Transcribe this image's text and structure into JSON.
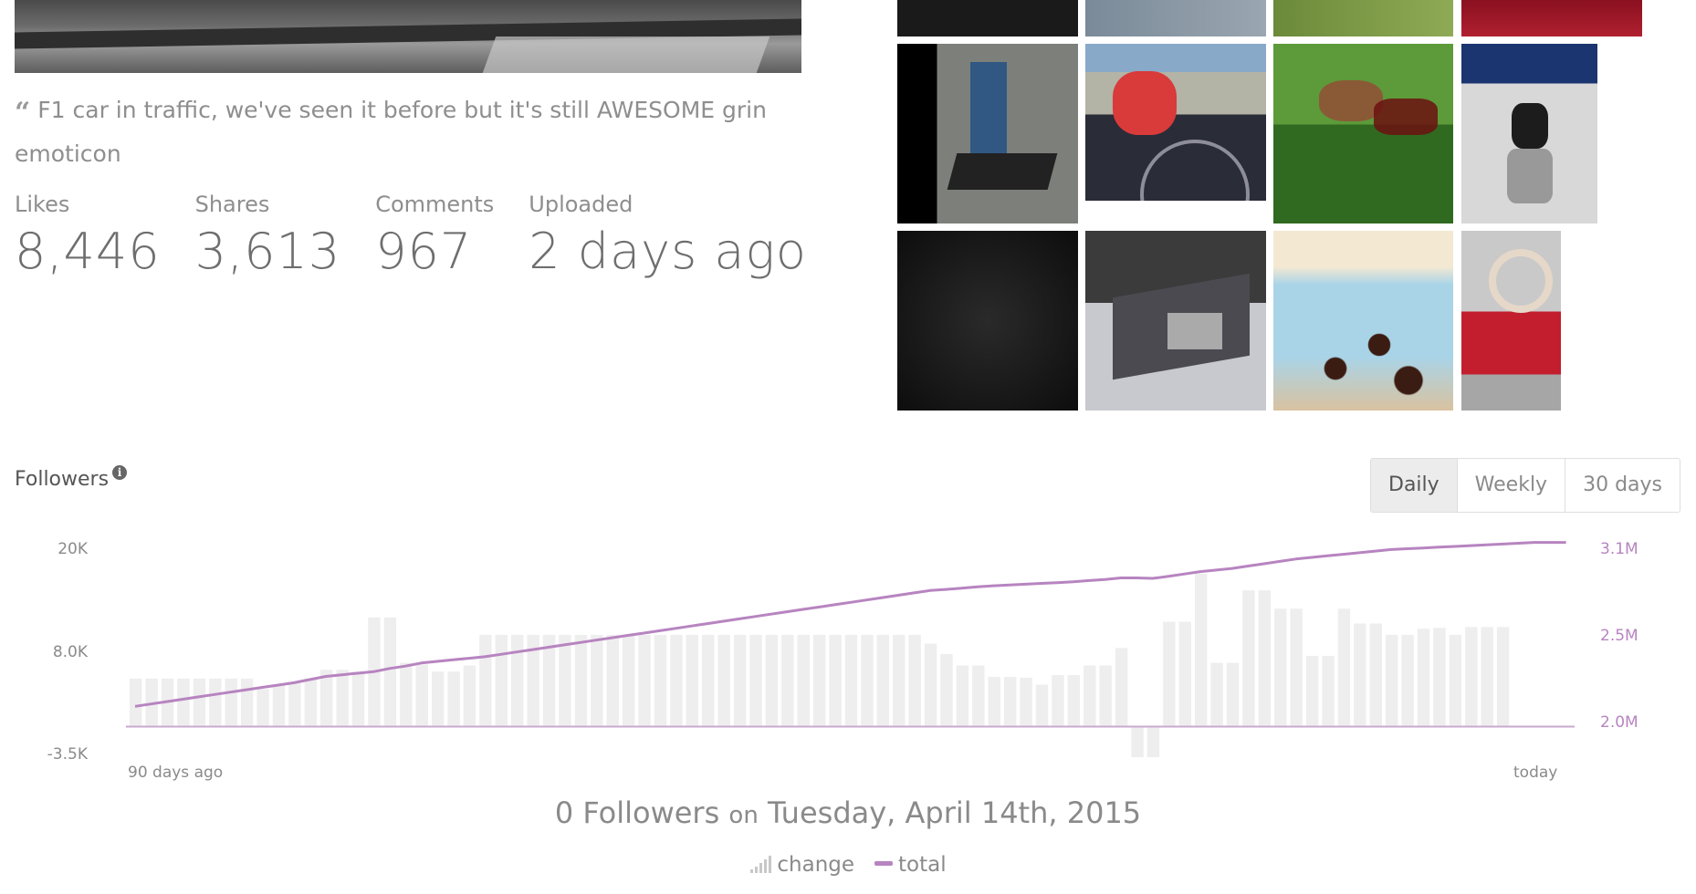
{
  "post": {
    "caption": "F1 car in traffic, we've seen it before but it's still AWESOME grin emoticon",
    "stats": [
      {
        "label": "Likes",
        "value": "8,446"
      },
      {
        "label": "Shares",
        "value": "3,613"
      },
      {
        "label": "Comments",
        "value": "967"
      },
      {
        "label": "Uploaded",
        "value": "2 days ago"
      }
    ]
  },
  "followers": {
    "title": "Followers",
    "periods": [
      "Daily",
      "Weekly",
      "30 days"
    ],
    "active_period": "Daily",
    "y_left_ticks": [
      "20K",
      "8.0K",
      "-3.5K"
    ],
    "y_right_ticks": [
      "3.1M",
      "2.5M",
      "2.0M"
    ],
    "x_start_label": "90 days ago",
    "x_end_label": "today",
    "summary": {
      "value": "0 Followers",
      "on": "on",
      "date": "Tuesday, April 14th, 2015"
    },
    "legend": {
      "change": "change",
      "total": "total"
    },
    "colors": {
      "bars": "#eeeeee",
      "line": "#b784c0",
      "baseline": "#c9a9cf"
    }
  },
  "chart_data": {
    "type": "bar",
    "x_range": [
      "90 days ago",
      "today"
    ],
    "ylim_left": [
      -3500,
      20000
    ],
    "ylim_right": [
      2000000,
      3100000
    ],
    "series": [
      {
        "name": "change",
        "type": "bar",
        "values": [
          5500,
          5500,
          5500,
          5500,
          5500,
          5500,
          5500,
          5500,
          4300,
          4700,
          5100,
          5500,
          6500,
          6500,
          6300,
          12500,
          12500,
          7300,
          7100,
          6300,
          6300,
          7000,
          10500,
          10500,
          10500,
          10500,
          10500,
          10500,
          10500,
          10500,
          10500,
          10500,
          10500,
          10500,
          10500,
          10500,
          10500,
          10500,
          10500,
          10500,
          10500,
          10500,
          10500,
          10500,
          10500,
          10500,
          10500,
          10500,
          10500,
          10500,
          9500,
          8300,
          7000,
          7000,
          5700,
          5700,
          5600,
          4800,
          5900,
          5900,
          7000,
          7000,
          9000,
          -3500,
          -3500,
          12000,
          12000,
          17500,
          7300,
          7300,
          15600,
          15600,
          13500,
          13500,
          8100,
          8100,
          13500,
          11800,
          11800,
          10500,
          10500,
          11200,
          11300,
          10500,
          11400,
          11400,
          11400,
          0,
          0,
          0,
          0
        ],
        "note_zero": ""
      },
      {
        "name": "total",
        "type": "line",
        "values": [
          2120000,
          2135000,
          2150000,
          2165000,
          2180000,
          2195000,
          2210000,
          2225000,
          2240000,
          2255000,
          2270000,
          2290000,
          2310000,
          2320000,
          2330000,
          2340000,
          2360000,
          2375000,
          2395000,
          2405000,
          2415000,
          2425000,
          2435000,
          2450000,
          2465000,
          2480000,
          2495000,
          2510000,
          2525000,
          2540000,
          2555000,
          2570000,
          2585000,
          2600000,
          2615000,
          2630000,
          2645000,
          2660000,
          2675000,
          2690000,
          2705000,
          2720000,
          2735000,
          2750000,
          2765000,
          2780000,
          2795000,
          2810000,
          2825000,
          2840000,
          2855000,
          2862000,
          2870000,
          2878000,
          2885000,
          2890000,
          2895000,
          2900000,
          2905000,
          2910000,
          2918000,
          2925000,
          2935000,
          2935000,
          2932000,
          2945000,
          2960000,
          2975000,
          2985000,
          2995000,
          3010000,
          3025000,
          3040000,
          3055000,
          3065000,
          3075000,
          3085000,
          3095000,
          3105000,
          3115000,
          3120000,
          3125000,
          3130000,
          3135000,
          3140000,
          3145000,
          3150000,
          3155000,
          3160000,
          3160000,
          3160000
        ]
      }
    ],
    "xlabel": "",
    "ylabel": ""
  }
}
